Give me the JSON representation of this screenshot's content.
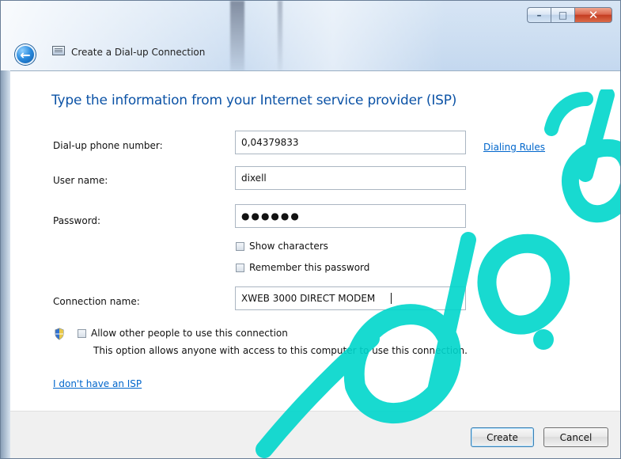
{
  "window": {
    "title": "Create a Dial-up Connection",
    "controls": {
      "minimize": "–",
      "maximize": "□",
      "close": "✕"
    }
  },
  "content": {
    "heading": "Type the information from your Internet service provider (ISP)",
    "fields": {
      "phone": {
        "label": "Dial-up phone number:",
        "value": "0,04379833"
      },
      "username": {
        "label": "User name:",
        "value": "dixell"
      },
      "password": {
        "label": "Password:",
        "value": "●●●●●●"
      },
      "connection_name": {
        "label": "Connection name:",
        "value": "XWEB 3000 DIRECT MODEM"
      }
    },
    "links": {
      "dialing_rules": "Dialing Rules",
      "no_isp": "I don't have an ISP"
    },
    "checkboxes": {
      "show_characters": "Show characters",
      "remember_password": "Remember this password",
      "allow_others": "Allow other people to use this connection"
    },
    "allow_others_description": "This option allows anyone with access to this computer to use this connection."
  },
  "footer": {
    "create": "Create",
    "cancel": "Cancel"
  },
  "colors": {
    "heading": "#0c53a6",
    "link": "#0066cc",
    "watermark": "#00d6cc"
  },
  "icons": {
    "back": "back-arrow-icon",
    "connection": "dialup-connection-icon",
    "shield": "uac-shield-icon"
  }
}
